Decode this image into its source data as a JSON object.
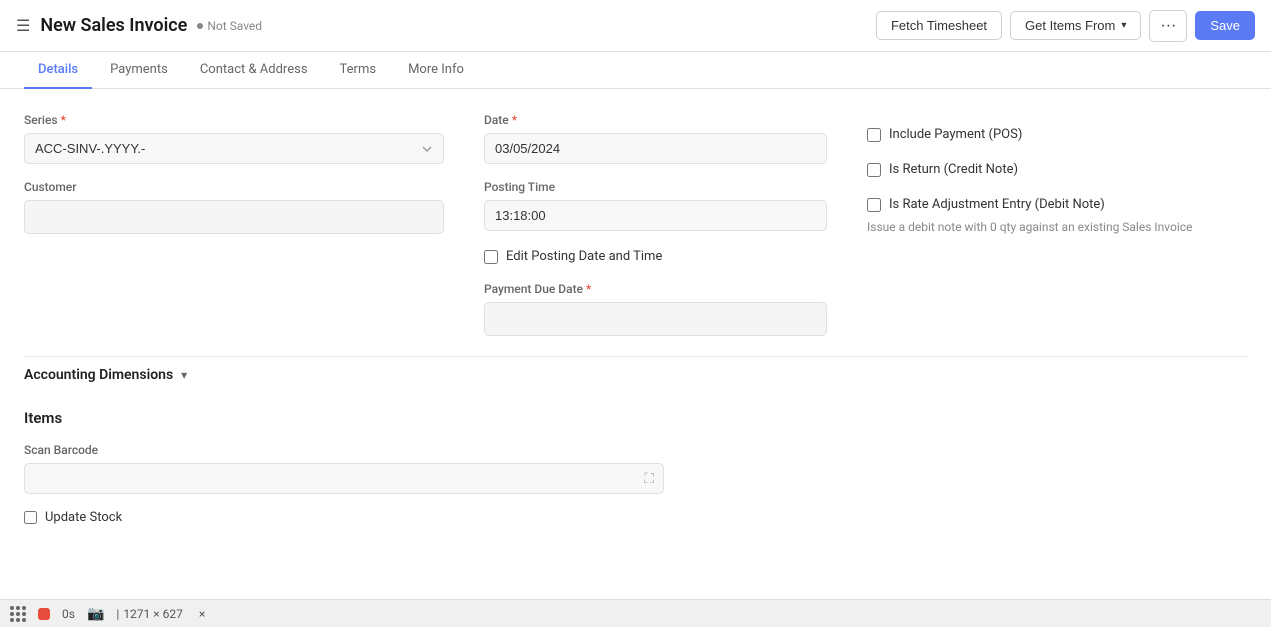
{
  "header": {
    "title": "New Sales Invoice",
    "not_saved": "Not Saved",
    "fetch_timesheet": "Fetch Timesheet",
    "get_items_from": "Get Items From",
    "more_options": "···",
    "save": "Save"
  },
  "tabs": [
    {
      "id": "details",
      "label": "Details",
      "active": true
    },
    {
      "id": "payments",
      "label": "Payments",
      "active": false
    },
    {
      "id": "contact-address",
      "label": "Contact & Address",
      "active": false
    },
    {
      "id": "terms",
      "label": "Terms",
      "active": false
    },
    {
      "id": "more-info",
      "label": "More Info",
      "active": false
    }
  ],
  "form": {
    "series_label": "Series",
    "series_value": "ACC-SINV-.YYYY.-",
    "customer_label": "Customer",
    "customer_placeholder": "",
    "date_label": "Date",
    "date_value": "03/05/2024",
    "posting_time_label": "Posting Time",
    "posting_time_value": "13:18:00",
    "edit_posting_date_label": "Edit Posting Date and Time",
    "payment_due_date_label": "Payment Due Date",
    "include_payment_label": "Include Payment (POS)",
    "is_return_label": "Is Return (Credit Note)",
    "is_rate_adjustment_label": "Is Rate Adjustment Entry (Debit Note)",
    "debit_note_hint": "Issue a debit note with 0 qty against an existing Sales Invoice"
  },
  "accounting_dimensions": {
    "title": "Accounting Dimensions",
    "collapsed": false
  },
  "items_section": {
    "title": "Items",
    "scan_barcode_label": "Scan Barcode",
    "scan_barcode_placeholder": "",
    "update_stock_label": "Update Stock"
  },
  "status_bar": {
    "timer": "0s",
    "dimensions": "1271 × 627",
    "close": "×"
  }
}
